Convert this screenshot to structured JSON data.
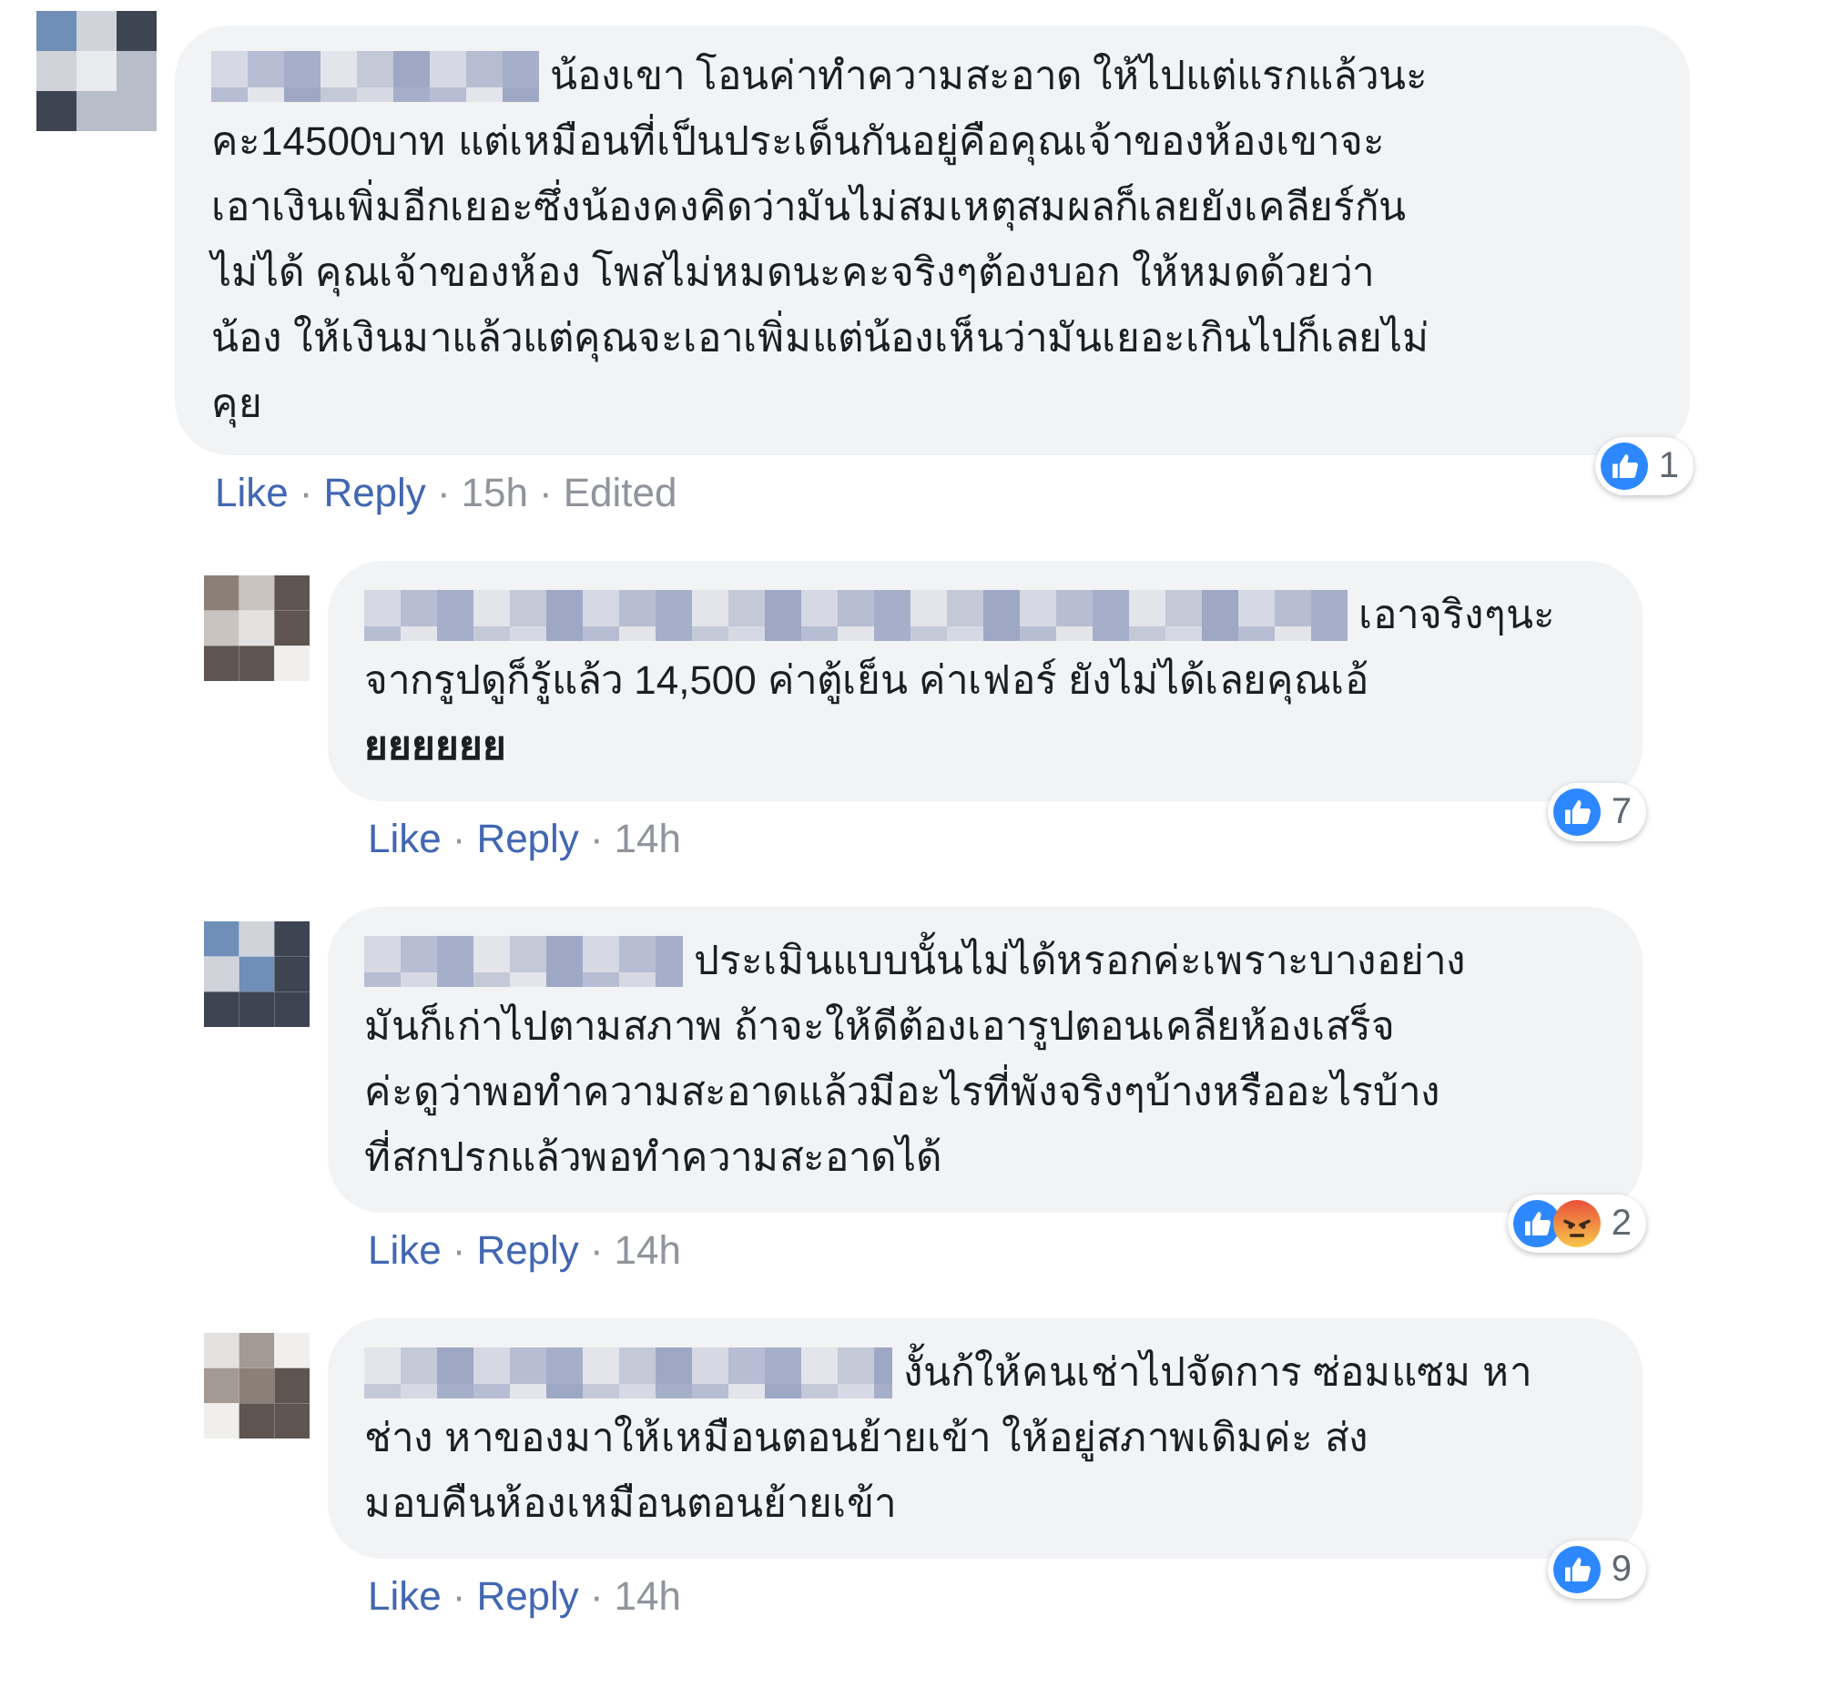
{
  "comments": [
    {
      "text": "น้องเขา โอนค่าทำความสะอาด ให้ไปแต่แรกแล้วนะ\nคะ14500บาท แต่เหมือนที่เป็นประเด็นกันอยู่คือคุณเจ้าของห้องเขาจะ\nเอาเงินเพิ่มอีกเยอะซึ่งน้องคงคิดว่ามันไม่สมเหตุสมผลก็เลยยังเคลียร์กัน\nไม่ได้ คุณเจ้าของห้อง โพสไม่หมดนะคะจริงๆต้องบอก ให้หมดด้วยว่า\nน้อง ให้เงินมาแล้วแต่คุณจะเอาเพิ่มแต่น้องเห็นว่ามันเยอะเกินไปก็เลยไม่\nคุย",
      "reactions": {
        "like": true,
        "angry": false
      },
      "reaction_count": "1",
      "meta": [
        {
          "text": "Like",
          "kind": "link"
        },
        {
          "text": "·",
          "kind": "dot"
        },
        {
          "text": "Reply",
          "kind": "link"
        },
        {
          "text": "·",
          "kind": "dot"
        },
        {
          "text": "15h",
          "kind": "info"
        },
        {
          "text": "·",
          "kind": "dot"
        },
        {
          "text": "Edited",
          "kind": "info"
        }
      ],
      "replies": [
        {
          "text": "เอาจริงๆนะ\nจากรูปดูก็รู้แล้ว 14,500 ค่าตู้เย็น ค่าเฟอร์ ยังไม่ได้เลยคุณเอ้\n**ยยยยยย**",
          "reactions": {
            "like": true,
            "angry": false
          },
          "reaction_count": "7",
          "meta": [
            {
              "text": "Like",
              "kind": "link"
            },
            {
              "text": "·",
              "kind": "dot"
            },
            {
              "text": "Reply",
              "kind": "link"
            },
            {
              "text": "·",
              "kind": "dot"
            },
            {
              "text": "14h",
              "kind": "info"
            }
          ]
        },
        {
          "text": "ประเมินแบบนั้นไม่ได้หรอกค่ะเพราะบางอย่าง\nมันก็เก่าไปตามสภาพ ถ้าจะให้ดีต้องเอารูปตอนเคลียห้องเสร็จ\nค่ะดูว่าพอทำความสะอาดแล้วมีอะไรที่พังจริงๆบ้างหรืออะไรบ้าง\nที่สกปรกแล้วพอทำความสะอาดได้",
          "reactions": {
            "like": true,
            "angry": true
          },
          "reaction_count": "2",
          "meta": [
            {
              "text": "Like",
              "kind": "link"
            },
            {
              "text": "·",
              "kind": "dot"
            },
            {
              "text": "Reply",
              "kind": "link"
            },
            {
              "text": "·",
              "kind": "dot"
            },
            {
              "text": "14h",
              "kind": "info"
            }
          ]
        },
        {
          "text": "งั้นก้ให้คนเช่าไปจัดการ ซ่อมแซม หา\nช่าง หาของมาให้เหมือนตอนย้ายเข้า ให้อยู่สภาพเดิมค่ะ ส่ง\nมอบคืนห้องเหมือนตอนย้ายเข้า",
          "reactions": {
            "like": true,
            "angry": false
          },
          "reaction_count": "9",
          "meta": [
            {
              "text": "Like",
              "kind": "link"
            },
            {
              "text": "·",
              "kind": "dot"
            },
            {
              "text": "Reply",
              "kind": "link"
            },
            {
              "text": "·",
              "kind": "dot"
            },
            {
              "text": "14h",
              "kind": "info"
            }
          ]
        }
      ]
    }
  ]
}
